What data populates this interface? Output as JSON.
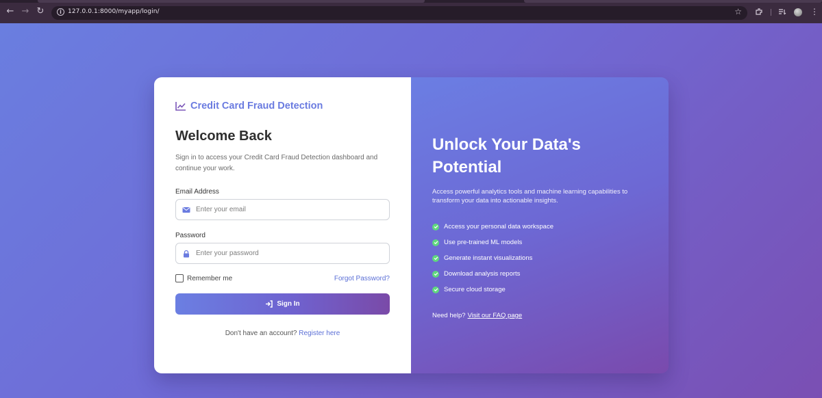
{
  "browser": {
    "url": "127.0.0.1:8000/myapp/login/"
  },
  "colors": {
    "brand": "#6a7be0",
    "link": "#5b6fd6",
    "check": "#5fd87e",
    "gradient_start": "#6b7fe2",
    "gradient_end": "#7a4aa8"
  },
  "brand": {
    "icon": "line-chart-icon",
    "title": "Credit Card Fraud Detection"
  },
  "login": {
    "heading": "Welcome Back",
    "subtitle": "Sign in to access your Credit Card Fraud Detection dashboard and continue your work.",
    "email_label": "Email Address",
    "email_placeholder": "Enter your email",
    "email_value": "",
    "email_icon": "envelope-icon",
    "password_label": "Password",
    "password_placeholder": "Enter your password",
    "password_value": "",
    "password_icon": "lock-icon",
    "remember_label": "Remember me",
    "remember_checked": false,
    "forgot_label": "Forgot Password?",
    "signin_label": "Sign In",
    "signin_icon": "sign-in-icon",
    "register_prompt": "Don't have an account?",
    "register_link": "Register here"
  },
  "promo": {
    "headline": "Unlock Your Data's Potential",
    "description": "Access powerful analytics tools and machine learning capabilities to transform your data into actionable insights.",
    "features": [
      "Access your personal data workspace",
      "Use pre-trained ML models",
      "Generate instant visualizations",
      "Download analysis reports",
      "Secure cloud storage"
    ],
    "help_prompt": "Need help?",
    "help_link": "Visit our FAQ page"
  }
}
